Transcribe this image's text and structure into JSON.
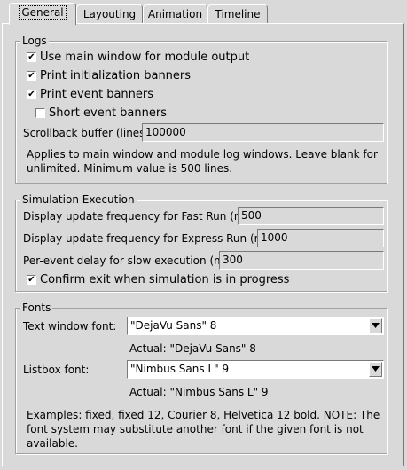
{
  "tabs": [
    {
      "label": "General"
    },
    {
      "label": "Layouting"
    },
    {
      "label": "Animation"
    },
    {
      "label": "Timeline"
    }
  ],
  "logs": {
    "title": "Logs",
    "use_main_window": {
      "label": "Use main window for module output",
      "checked": true,
      "mark": "✔"
    },
    "print_init": {
      "label": "Print initialization banners",
      "checked": true,
      "mark": "✔"
    },
    "print_event": {
      "label": "Print event banners",
      "checked": true,
      "mark": "✔"
    },
    "short_event": {
      "label": "Short event banners",
      "checked": false,
      "mark": ""
    },
    "scrollback_label": "Scrollback buffer (lines):",
    "scrollback_value": "100000",
    "note": "Applies to main window and module log windows. Leave blank for unlimited. Minimum value is 500 lines."
  },
  "sim": {
    "title": "Simulation Execution",
    "fast_label": "Display update frequency for Fast Run (ms):",
    "fast_value": "500",
    "express_label": "Display update frequency for Express Run (ms):",
    "express_value": "1000",
    "delay_label": "Per-event delay for slow execution (ms):",
    "delay_value": "300",
    "confirm_exit": {
      "label": "Confirm exit when simulation is in progress",
      "checked": true,
      "mark": "✔"
    }
  },
  "fonts": {
    "title": "Fonts",
    "text_window_label": "Text window font:",
    "text_window_value": "\"DejaVu Sans\" 8",
    "text_window_actual": "Actual: \"DejaVu Sans\" 8",
    "listbox_label": "Listbox font:",
    "listbox_value": "\"Nimbus Sans L\" 9",
    "listbox_actual": "Actual: \"Nimbus Sans L\" 9",
    "note": "Examples: fixed, fixed 12, Courier 8, Helvetica 12 bold. NOTE: The font system may substitute another font if the given font is not available."
  }
}
